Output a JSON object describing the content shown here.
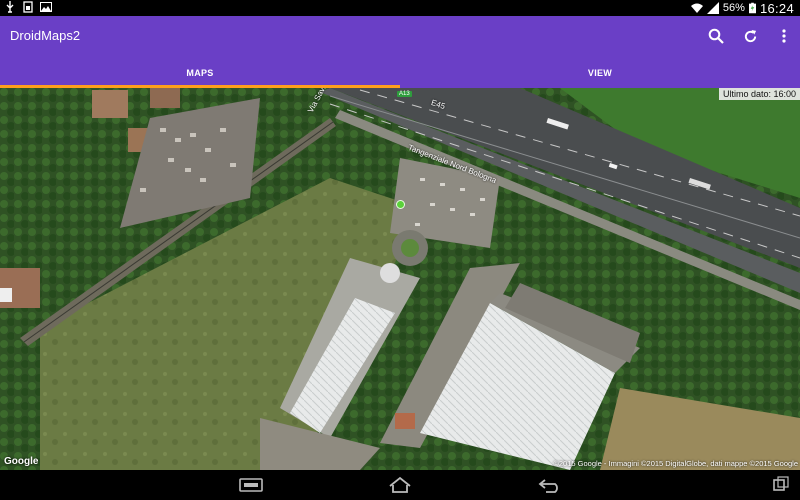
{
  "status_bar": {
    "left_icons": [
      "usb-icon",
      "sim-icon",
      "image-icon"
    ],
    "wifi": "wifi-icon",
    "signal": "signal-icon",
    "battery_percent": "56%",
    "clock": "16:24"
  },
  "app_bar": {
    "title": "DroidMaps2",
    "actions": [
      "search-icon",
      "refresh-icon",
      "more-vert-icon"
    ]
  },
  "tabs": [
    {
      "label": "MAPS",
      "selected": true
    },
    {
      "label": "VIEW",
      "selected": false
    }
  ],
  "colors": {
    "primary": "#6a3fc6",
    "tab_indicator": "#ff9f1c",
    "location_dot": "#5ad13a"
  },
  "map": {
    "update_text": "Ultimo dato: 16:00",
    "road_labels": {
      "street": "Via Savioli",
      "highway_code": "E45",
      "highway_name": "Tangenziale Nord Bologna"
    },
    "route_badge": "A13",
    "google_logo": "Google",
    "attribution": "©2015 Google - Immagini ©2015 DigitalGlobe, dati mappe ©2015 Google"
  },
  "nav_bar": [
    "back-icon",
    "home-icon",
    "recents-icon",
    "keyboard-icon"
  ]
}
